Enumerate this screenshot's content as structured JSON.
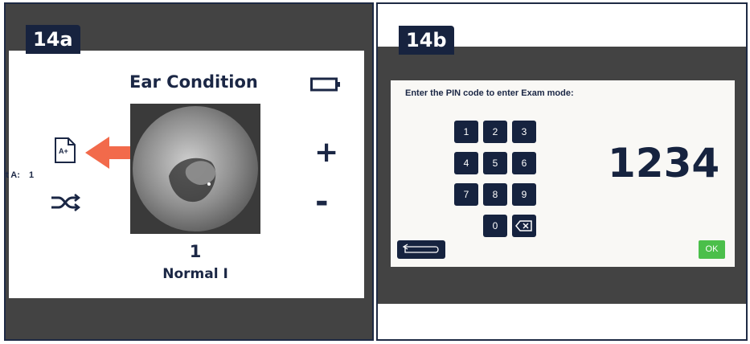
{
  "panel_a": {
    "tag": "14a",
    "title": "Ear Condition",
    "side_label": "t A:",
    "side_value": "1",
    "doc_icon_text": "A+",
    "plus": "+",
    "minus": "-",
    "condition_number": "1",
    "condition_label": "Normal I",
    "icons": [
      "battery-icon",
      "document-grade-icon",
      "arrow-left-icon",
      "shuffle-icon",
      "plus-icon",
      "minus-icon"
    ]
  },
  "panel_b": {
    "tag": "14b",
    "prompt": "Enter the PIN code to enter Exam mode:",
    "keys": [
      "1",
      "2",
      "3",
      "4",
      "5",
      "6",
      "7",
      "8",
      "9",
      "0"
    ],
    "pin": "1234",
    "ok_label": "OK",
    "icons": [
      "backspace-icon",
      "back-arrow-icon"
    ]
  },
  "colors": {
    "navy": "#16233f",
    "arrow_orange": "#f26a4b",
    "ok_green": "#4bbf4a",
    "frame_gray": "#434343"
  }
}
